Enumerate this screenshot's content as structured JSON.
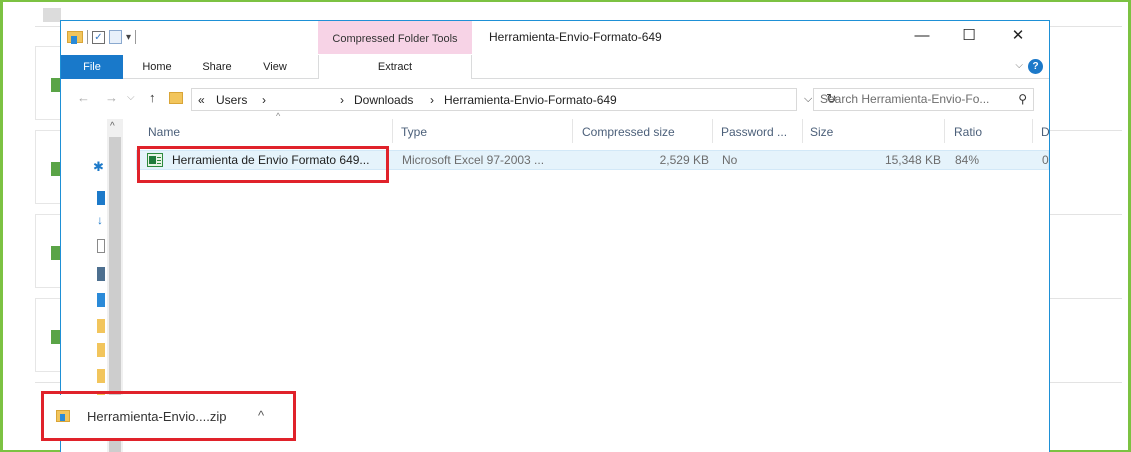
{
  "qat": {
    "dropdown_glyph": "▾"
  },
  "window": {
    "context_group": "Compressed Folder Tools",
    "title": "Herramienta-Envio-Formato-649",
    "controls": {
      "minimize": "—",
      "maximize": "☐",
      "close": "✕"
    }
  },
  "ribbon": {
    "tabs": [
      {
        "label": "File"
      },
      {
        "label": "Home"
      },
      {
        "label": "Share"
      },
      {
        "label": "View"
      },
      {
        "label": "Extract"
      }
    ],
    "expand_glyph": "⌵",
    "help_glyph": "?"
  },
  "navigation": {
    "back": "←",
    "forward": "→",
    "recent": "⌵",
    "up": "↑",
    "address": {
      "prefix": "«",
      "crumbs": [
        "Users",
        "Downloads",
        "Herramienta-Envio-Formato-649"
      ],
      "separator": "›",
      "dropdown": "⌵",
      "refresh": "↻"
    },
    "search": {
      "placeholder": "Search Herramienta-Envio-Fo...",
      "icon": "⚲"
    }
  },
  "file_list": {
    "columns": [
      "Name",
      "Type",
      "Compressed size",
      "Password ...",
      "Size",
      "Ratio",
      "D"
    ],
    "rows": [
      {
        "name": "Herramienta de Envio Formato 649...",
        "type": "Microsoft Excel 97-2003 ...",
        "compressed_size": "2,529 KB",
        "password": "No",
        "size": "15,348 KB",
        "ratio": "84%",
        "date": "0"
      }
    ]
  },
  "download_bar": {
    "filename": "Herramienta-Envio....zip",
    "caret": "^"
  },
  "colors": {
    "frame_green": "#7cc242",
    "file_tab_blue": "#1979ca",
    "context_pink": "#f7d3e6",
    "highlight_red": "#e0222a",
    "selection_blue": "#e5f3fb"
  }
}
